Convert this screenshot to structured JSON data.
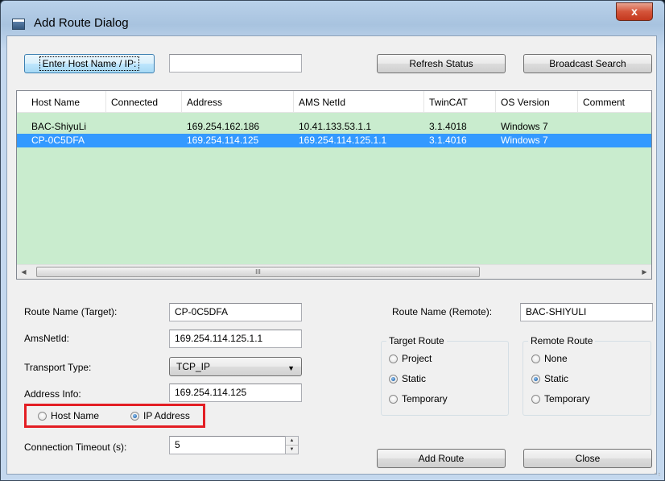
{
  "window": {
    "title": "Add Route Dialog",
    "close_glyph": "x"
  },
  "toolbar": {
    "enter_host_button": "Enter Host Name / IP:",
    "host_input_value": "",
    "refresh_button": "Refresh Status",
    "broadcast_button": "Broadcast Search"
  },
  "list": {
    "columns": [
      "Host Name",
      "Connected",
      "Address",
      "AMS NetId",
      "TwinCAT",
      "OS Version",
      "Comment"
    ],
    "rows": [
      {
        "host": "BAC-ShiyuLi",
        "connected": "",
        "address": "169.254.162.186",
        "ams": "10.41.133.53.1.1",
        "twincat": "3.1.4018",
        "os": "Windows 7",
        "comment": ""
      },
      {
        "host": "CP-0C5DFA",
        "connected": "",
        "address": "169.254.114.125",
        "ams": "169.254.114.125.1.1",
        "twincat": "3.1.4016",
        "os": "Windows 7",
        "comment": ""
      }
    ],
    "selected_row": 1,
    "scroll_grip": "III"
  },
  "form": {
    "route_name_target_label": "Route Name (Target):",
    "route_name_target_value": "CP-0C5DFA",
    "amsnetid_label": "AmsNetId:",
    "amsnetid_value": "169.254.114.125.1.1",
    "transport_label": "Transport Type:",
    "transport_value": "TCP_IP",
    "address_info_label": "Address Info:",
    "address_info_value": "169.254.114.125",
    "radio_host_name": "Host Name",
    "radio_ip_address": "IP Address",
    "timeout_label": "Connection Timeout (s):",
    "timeout_value": "5",
    "route_name_remote_label": "Route Name (Remote):",
    "route_name_remote_value": "BAC-SHIYULI"
  },
  "target_route": {
    "title": "Target Route",
    "options": [
      "Project",
      "Static",
      "Temporary"
    ],
    "selected": "Static"
  },
  "remote_route": {
    "title": "Remote Route",
    "options": [
      "None",
      "Static",
      "Temporary"
    ],
    "selected": "Static"
  },
  "buttons": {
    "add_route": "Add Route",
    "close": "Close"
  },
  "colors": {
    "list_background": "#c9ecce",
    "selection": "#3399ff",
    "highlight_box": "#e31e24"
  }
}
